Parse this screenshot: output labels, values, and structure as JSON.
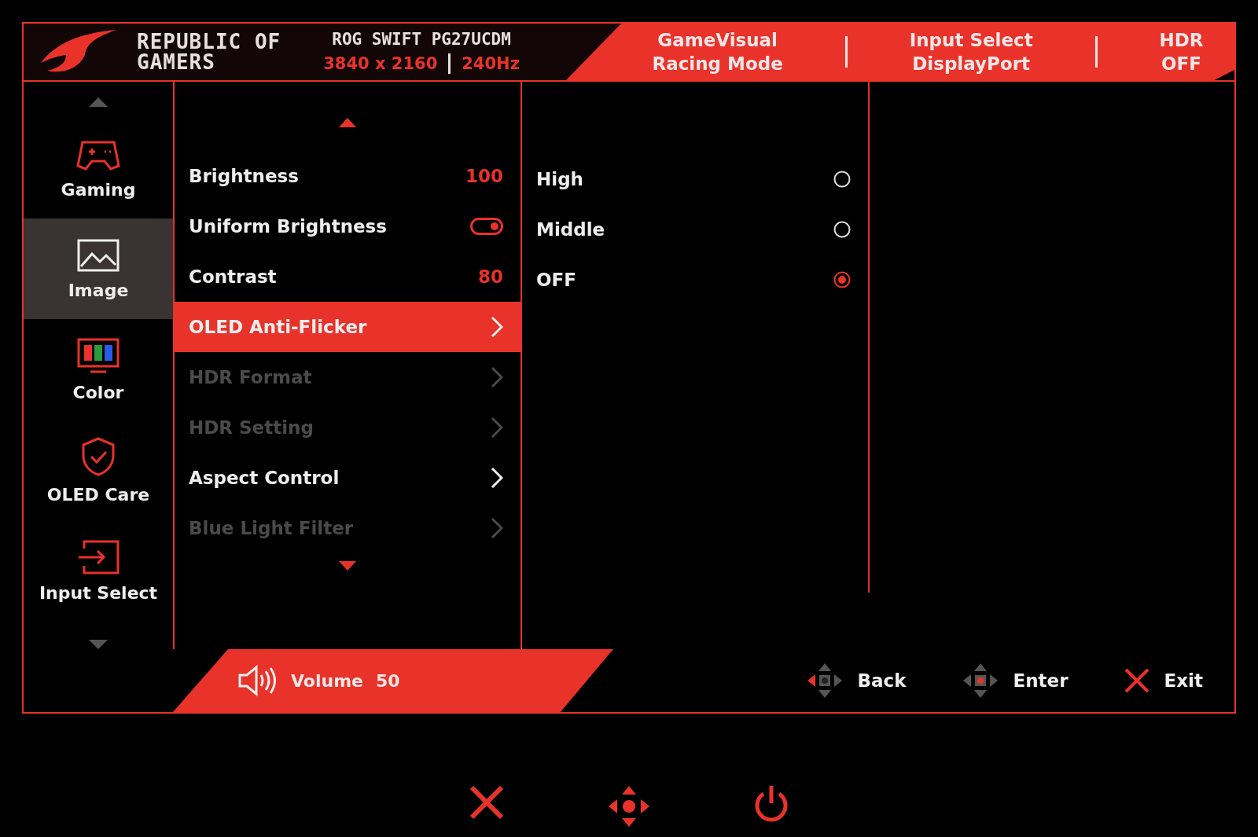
{
  "header": {
    "brand": [
      "REPUBLIC OF",
      "GAMERS"
    ],
    "model": "ROG SWIFT PG27UCDM",
    "resolution": "3840 x 2160",
    "refresh": "240Hz",
    "status": [
      {
        "label": "GameVisual",
        "value": "Racing Mode"
      },
      {
        "label": "Input Select",
        "value": "DisplayPort"
      },
      {
        "label": "HDR",
        "value": "OFF"
      }
    ]
  },
  "sidebar": {
    "items": [
      {
        "kind": "gamepad",
        "label": "Gaming",
        "selected": false
      },
      {
        "kind": "image",
        "label": "Image",
        "selected": true
      },
      {
        "kind": "color",
        "label": "Color",
        "selected": false
      },
      {
        "kind": "shield",
        "label": "OLED Care",
        "selected": false
      },
      {
        "kind": "input",
        "label": "Input Select",
        "selected": false
      }
    ]
  },
  "menu": {
    "items": [
      {
        "kind": "value",
        "label": "Brightness",
        "value": "100",
        "selected": false,
        "disabled": false
      },
      {
        "kind": "toggle",
        "label": "Uniform Brightness",
        "on": true,
        "selected": false,
        "disabled": false
      },
      {
        "kind": "value",
        "label": "Contrast",
        "value": "80",
        "selected": false,
        "disabled": false
      },
      {
        "kind": "submenu",
        "label": "OLED Anti-Flicker",
        "selected": true,
        "disabled": false
      },
      {
        "kind": "submenu",
        "label": "HDR Format",
        "selected": false,
        "disabled": true
      },
      {
        "kind": "submenu",
        "label": "HDR Setting",
        "selected": false,
        "disabled": true
      },
      {
        "kind": "submenu",
        "label": "Aspect Control",
        "selected": false,
        "disabled": false
      },
      {
        "kind": "submenu",
        "label": "Blue Light Filter",
        "selected": false,
        "disabled": true
      }
    ]
  },
  "options": [
    {
      "label": "High",
      "selected": false
    },
    {
      "label": "Middle",
      "selected": false
    },
    {
      "label": "OFF",
      "selected": true
    }
  ],
  "footer": {
    "volume": {
      "label": "Volume",
      "value": "50"
    },
    "nav": [
      {
        "kind": "back",
        "label": "Back"
      },
      {
        "kind": "enter",
        "label": "Enter"
      },
      {
        "kind": "exit",
        "label": "Exit"
      }
    ]
  },
  "buttons": [
    {
      "kind": "close"
    },
    {
      "kind": "joystick"
    },
    {
      "kind": "power"
    }
  ]
}
